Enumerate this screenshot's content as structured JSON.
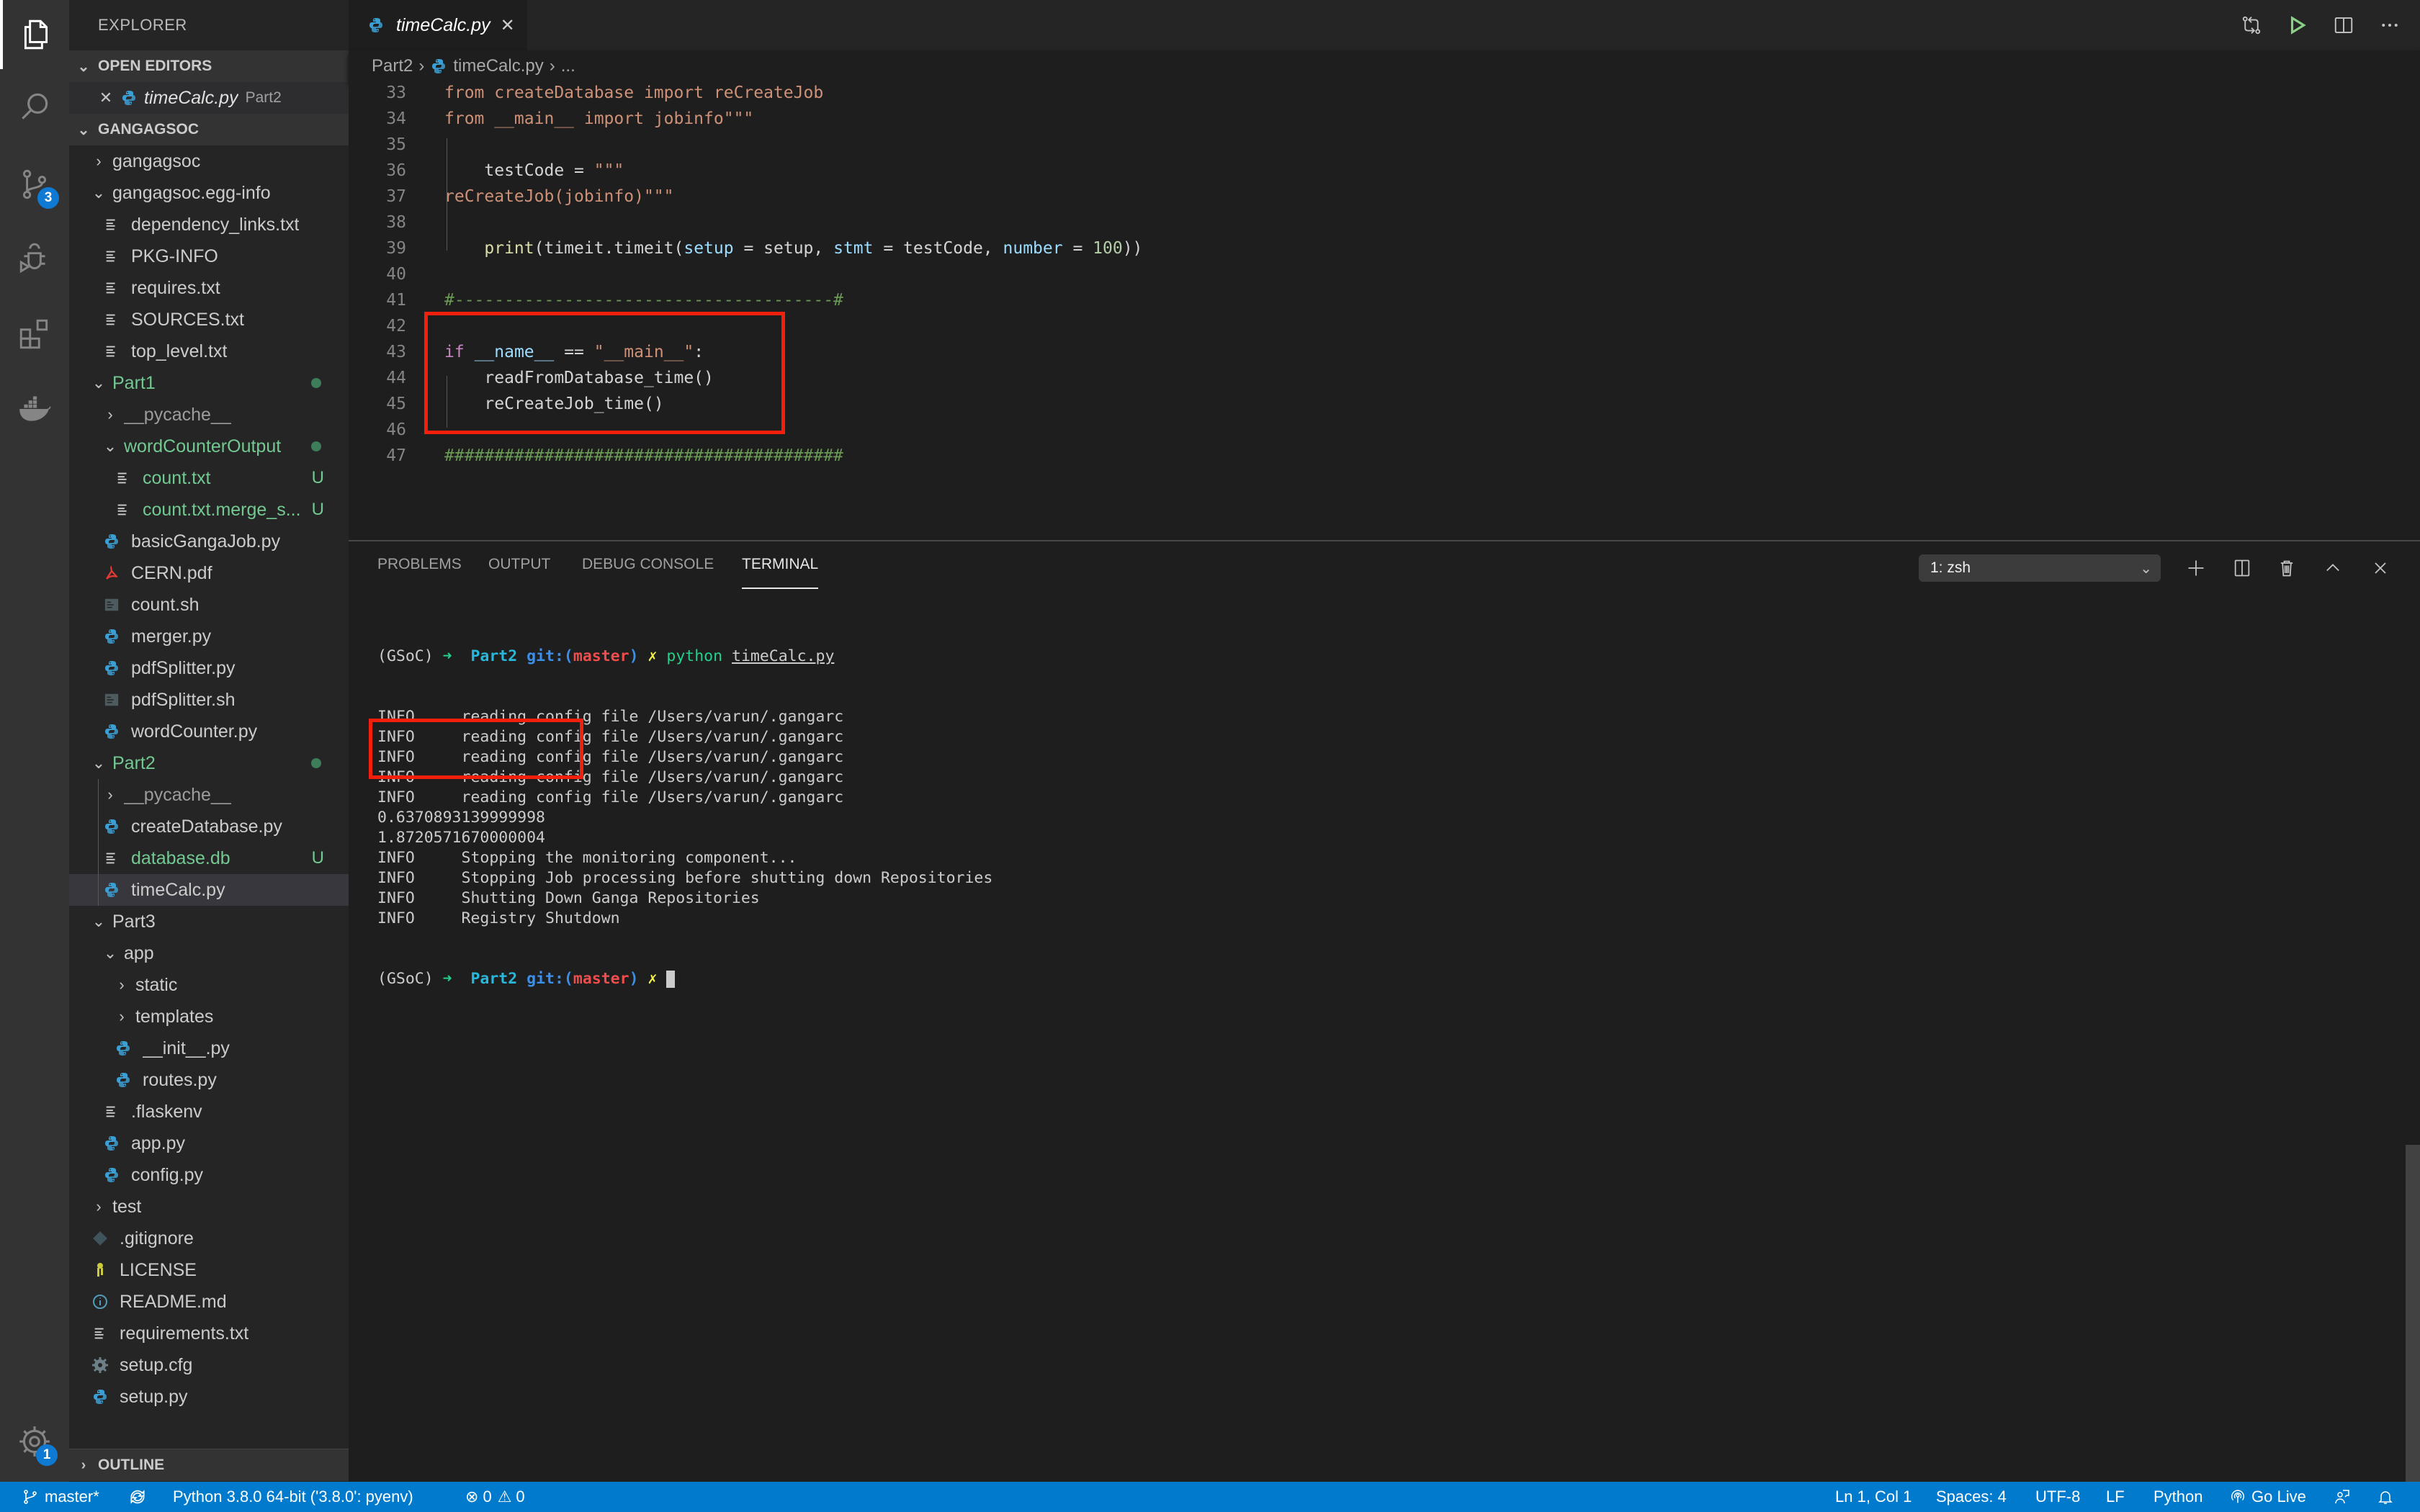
{
  "activity_bar": {
    "items": [
      {
        "name": "explorer",
        "icon": "files-icon",
        "active": true
      },
      {
        "name": "search",
        "icon": "search-icon"
      },
      {
        "name": "source-control",
        "icon": "source-control-icon",
        "badge": "3"
      },
      {
        "name": "run-debug",
        "icon": "debug-icon"
      },
      {
        "name": "extensions",
        "icon": "extensions-icon"
      },
      {
        "name": "docker",
        "icon": "docker-icon"
      }
    ],
    "manage": {
      "icon": "gear-icon",
      "badge": "1"
    }
  },
  "sidebar": {
    "title": "EXPLORER",
    "open_editors": {
      "header": "OPEN EDITORS",
      "items": [
        {
          "name": "timeCalc.py",
          "folder": "Part2",
          "icon": "python-icon"
        }
      ]
    },
    "workspace": {
      "header": "GANGAGSOC",
      "tree": [
        {
          "label": "gangagsoc",
          "type": "folder",
          "expanded": false,
          "depth": 0
        },
        {
          "label": "gangagsoc.egg-info",
          "type": "folder",
          "expanded": true,
          "depth": 0
        },
        {
          "label": "dependency_links.txt",
          "type": "file",
          "icon": "text-file-icon",
          "depth": 1
        },
        {
          "label": "PKG-INFO",
          "type": "file",
          "icon": "text-file-icon",
          "depth": 1
        },
        {
          "label": "requires.txt",
          "type": "file",
          "icon": "text-file-icon",
          "depth": 1
        },
        {
          "label": "SOURCES.txt",
          "type": "file",
          "icon": "text-file-icon",
          "depth": 1
        },
        {
          "label": "top_level.txt",
          "type": "file",
          "icon": "text-file-icon",
          "depth": 1
        },
        {
          "label": "Part1",
          "type": "folder",
          "expanded": true,
          "depth": 0,
          "git": "modified-dot"
        },
        {
          "label": "__pycache__",
          "type": "folder",
          "expanded": false,
          "depth": 1,
          "ignored": true
        },
        {
          "label": "wordCounterOutput",
          "type": "folder",
          "expanded": true,
          "depth": 1,
          "git": "modified-dot"
        },
        {
          "label": "count.txt",
          "type": "file",
          "icon": "text-file-icon",
          "depth": 2,
          "git": "U"
        },
        {
          "label": "count.txt.merge_s...",
          "type": "file",
          "icon": "text-file-icon",
          "depth": 2,
          "git": "U"
        },
        {
          "label": "basicGangaJob.py",
          "type": "file",
          "icon": "python-icon",
          "depth": 1
        },
        {
          "label": "CERN.pdf",
          "type": "file",
          "icon": "pdf-icon",
          "depth": 1
        },
        {
          "label": "count.sh",
          "type": "file",
          "icon": "shell-icon",
          "depth": 1
        },
        {
          "label": "merger.py",
          "type": "file",
          "icon": "python-icon",
          "depth": 1
        },
        {
          "label": "pdfSplitter.py",
          "type": "file",
          "icon": "python-icon",
          "depth": 1
        },
        {
          "label": "pdfSplitter.sh",
          "type": "file",
          "icon": "shell-icon",
          "depth": 1
        },
        {
          "label": "wordCounter.py",
          "type": "file",
          "icon": "python-icon",
          "depth": 1
        },
        {
          "label": "Part2",
          "type": "folder",
          "expanded": true,
          "depth": 0,
          "git": "modified-dot"
        },
        {
          "label": "__pycache__",
          "type": "folder",
          "expanded": false,
          "depth": 1,
          "ignored": true
        },
        {
          "label": "createDatabase.py",
          "type": "file",
          "icon": "python-icon",
          "depth": 1
        },
        {
          "label": "database.db",
          "type": "file",
          "icon": "text-file-icon",
          "depth": 1,
          "git": "U"
        },
        {
          "label": "timeCalc.py",
          "type": "file",
          "icon": "python-icon",
          "depth": 1,
          "selected": true
        },
        {
          "label": "Part3",
          "type": "folder",
          "expanded": true,
          "depth": 0
        },
        {
          "label": "app",
          "type": "folder",
          "expanded": true,
          "depth": 1
        },
        {
          "label": "static",
          "type": "folder",
          "expanded": false,
          "depth": 2
        },
        {
          "label": "templates",
          "type": "folder",
          "expanded": false,
          "depth": 2
        },
        {
          "label": "__init__.py",
          "type": "file",
          "icon": "python-icon",
          "depth": 2
        },
        {
          "label": "routes.py",
          "type": "file",
          "icon": "python-icon",
          "depth": 2
        },
        {
          "label": ".flaskenv",
          "type": "file",
          "icon": "text-file-icon",
          "depth": 1
        },
        {
          "label": "app.py",
          "type": "file",
          "icon": "python-icon",
          "depth": 1
        },
        {
          "label": "config.py",
          "type": "file",
          "icon": "python-icon",
          "depth": 1
        },
        {
          "label": "test",
          "type": "folder",
          "expanded": false,
          "depth": 0
        },
        {
          "label": ".gitignore",
          "type": "file",
          "icon": "git-icon",
          "depth": 0
        },
        {
          "label": "LICENSE",
          "type": "file",
          "icon": "license-icon",
          "depth": 0
        },
        {
          "label": "README.md",
          "type": "file",
          "icon": "info-icon",
          "depth": 0
        },
        {
          "label": "requirements.txt",
          "type": "file",
          "icon": "text-file-icon",
          "depth": 0
        },
        {
          "label": "setup.cfg",
          "type": "file",
          "icon": "settings-file-icon",
          "depth": 0
        },
        {
          "label": "setup.py",
          "type": "file",
          "icon": "python-icon",
          "depth": 0
        }
      ]
    },
    "outline": {
      "header": "OUTLINE"
    }
  },
  "editor": {
    "tab": {
      "label": "timeCalc.py",
      "icon": "python-icon"
    },
    "actions": [
      {
        "name": "open-changes",
        "icon": "compare-changes-icon"
      },
      {
        "name": "run-python-file",
        "icon": "play-icon"
      },
      {
        "name": "split-editor",
        "icon": "split-editor-icon"
      },
      {
        "name": "more-actions",
        "icon": "ellipsis-icon"
      }
    ],
    "breadcrumb": [
      "Part2",
      "timeCalc.py",
      "..."
    ],
    "lines": [
      {
        "n": "33",
        "tokens": [
          {
            "t": "from createDatabase import reCreateJob",
            "c": "str"
          }
        ]
      },
      {
        "n": "34",
        "tokens": [
          {
            "t": "from __main__ import jobinfo\"\"\"",
            "c": "str"
          }
        ]
      },
      {
        "n": "35",
        "tokens": []
      },
      {
        "n": "36",
        "tokens": [
          {
            "t": "    testCode = ",
            "c": ""
          },
          {
            "t": "\"\"\"",
            "c": "str"
          }
        ]
      },
      {
        "n": "37",
        "tokens": [
          {
            "t": "reCreateJob(jobinfo)\"\"\"",
            "c": "str"
          }
        ]
      },
      {
        "n": "38",
        "tokens": []
      },
      {
        "n": "39",
        "tokens": [
          {
            "t": "    ",
            "c": ""
          },
          {
            "t": "print",
            "c": "fn"
          },
          {
            "t": "(timeit.timeit(",
            "c": ""
          },
          {
            "t": "setup",
            "c": "var"
          },
          {
            "t": " = setup, ",
            "c": ""
          },
          {
            "t": "stmt",
            "c": "var"
          },
          {
            "t": " = testCode, ",
            "c": ""
          },
          {
            "t": "number",
            "c": "var"
          },
          {
            "t": " = ",
            "c": ""
          },
          {
            "t": "100",
            "c": "num"
          },
          {
            "t": "))",
            "c": ""
          }
        ]
      },
      {
        "n": "40",
        "tokens": []
      },
      {
        "n": "41",
        "tokens": [
          {
            "t": "#--------------------------------------#",
            "c": "cm"
          }
        ]
      },
      {
        "n": "42",
        "tokens": []
      },
      {
        "n": "43",
        "tokens": [
          {
            "t": "if",
            "c": "kw"
          },
          {
            "t": " ",
            "c": ""
          },
          {
            "t": "__name__",
            "c": "var"
          },
          {
            "t": " == ",
            "c": ""
          },
          {
            "t": "\"__main__\"",
            "c": "str"
          },
          {
            "t": ":",
            "c": ""
          }
        ]
      },
      {
        "n": "44",
        "tokens": [
          {
            "t": "    readFromDatabase_time()",
            "c": ""
          }
        ]
      },
      {
        "n": "45",
        "tokens": [
          {
            "t": "    reCreateJob_time()",
            "c": ""
          }
        ]
      },
      {
        "n": "46",
        "tokens": []
      },
      {
        "n": "47",
        "tokens": [
          {
            "t": "########################################",
            "c": "cm"
          }
        ]
      }
    ],
    "highlight_color": "#f21f0c"
  },
  "panel": {
    "tabs": [
      "PROBLEMS",
      "OUTPUT",
      "DEBUG CONSOLE",
      "TERMINAL"
    ],
    "active_tab": "TERMINAL",
    "terminal_select": "1: zsh",
    "actions": [
      {
        "name": "new-terminal",
        "icon": "plus-icon"
      },
      {
        "name": "split-terminal",
        "icon": "split-icon"
      },
      {
        "name": "kill-terminal",
        "icon": "trash-icon"
      },
      {
        "name": "maximize-panel",
        "icon": "chevron-up-icon"
      },
      {
        "name": "close-panel",
        "icon": "close-icon"
      }
    ],
    "terminal": {
      "prompt": {
        "env": "(GSoC)",
        "arrow": "➜",
        "dir": "Part2",
        "git_label": "git:(",
        "branch": "master",
        "git_close": ")",
        "dirty": "✗"
      },
      "command": {
        "bin": "python",
        "arg": "timeCalc.py"
      },
      "output": [
        {
          "level": "INFO",
          "msg": "reading config file /Users/varun/.gangarc"
        },
        {
          "level": "INFO",
          "msg": "reading config file /Users/varun/.gangarc"
        },
        {
          "level": "INFO",
          "msg": "reading config file /Users/varun/.gangarc"
        },
        {
          "level": "INFO",
          "msg": "reading config file /Users/varun/.gangarc"
        },
        {
          "level": "INFO",
          "msg": "reading config file /Users/varun/.gangarc"
        },
        {
          "level": "",
          "msg": "0.6370893139999998"
        },
        {
          "level": "",
          "msg": "1.8720571670000004"
        },
        {
          "level": "INFO",
          "msg": "Stopping the monitoring component..."
        },
        {
          "level": "INFO",
          "msg": "Stopping Job processing before shutting down Repositories"
        },
        {
          "level": "INFO",
          "msg": "Shutting Down Ganga Repositories"
        },
        {
          "level": "INFO",
          "msg": "Registry Shutdown"
        }
      ]
    }
  },
  "status_bar": {
    "branch": "master*",
    "sync_icon": "sync-icon",
    "interpreter": "Python 3.8.0 64-bit ('3.8.0': pyenv)",
    "errors": "0",
    "warnings": "0",
    "cursor": "Ln 1, Col 1",
    "spaces": "Spaces: 4",
    "encoding": "UTF-8",
    "eol": "LF",
    "language": "Python",
    "go_live": "Go Live",
    "color": "#007acc"
  }
}
